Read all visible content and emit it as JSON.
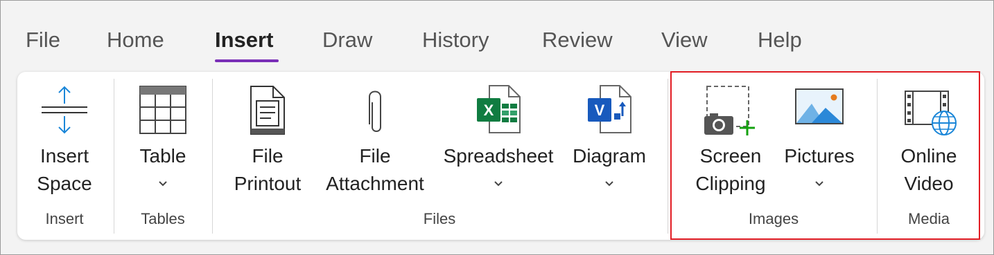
{
  "tabs": [
    {
      "label": "File"
    },
    {
      "label": "Home"
    },
    {
      "label": "Insert"
    },
    {
      "label": "Draw"
    },
    {
      "label": "History"
    },
    {
      "label": "Review"
    },
    {
      "label": "View"
    },
    {
      "label": "Help"
    }
  ],
  "active_tab": "Insert",
  "ribbon": {
    "insert_space": {
      "line1": "Insert",
      "line2": "Space",
      "icon": "insert-space-icon"
    },
    "table": {
      "label": "Table",
      "icon": "table-icon"
    },
    "file_printout": {
      "line1": "File",
      "line2": "Printout",
      "icon": "file-printout-icon"
    },
    "file_attachment": {
      "line1": "File",
      "line2": "Attachment",
      "icon": "paperclip-icon"
    },
    "spreadsheet": {
      "label": "Spreadsheet",
      "icon": "excel-icon"
    },
    "diagram": {
      "label": "Diagram",
      "icon": "visio-icon"
    },
    "screen_clipping": {
      "line1": "Screen",
      "line2": "Clipping",
      "icon": "screen-clipping-icon"
    },
    "pictures": {
      "label": "Pictures",
      "icon": "pictures-icon"
    },
    "online_video": {
      "line1": "Online",
      "line2": "Video",
      "icon": "online-video-icon"
    },
    "groups": {
      "insert": "Insert",
      "tables": "Tables",
      "files": "Files",
      "images": "Images",
      "media": "Media"
    }
  },
  "colors": {
    "accent": "#7a2fb7",
    "highlight": "#e21d24",
    "excel": "#107c41",
    "visio": "#185abd",
    "clip_plus": "#13a10e"
  }
}
